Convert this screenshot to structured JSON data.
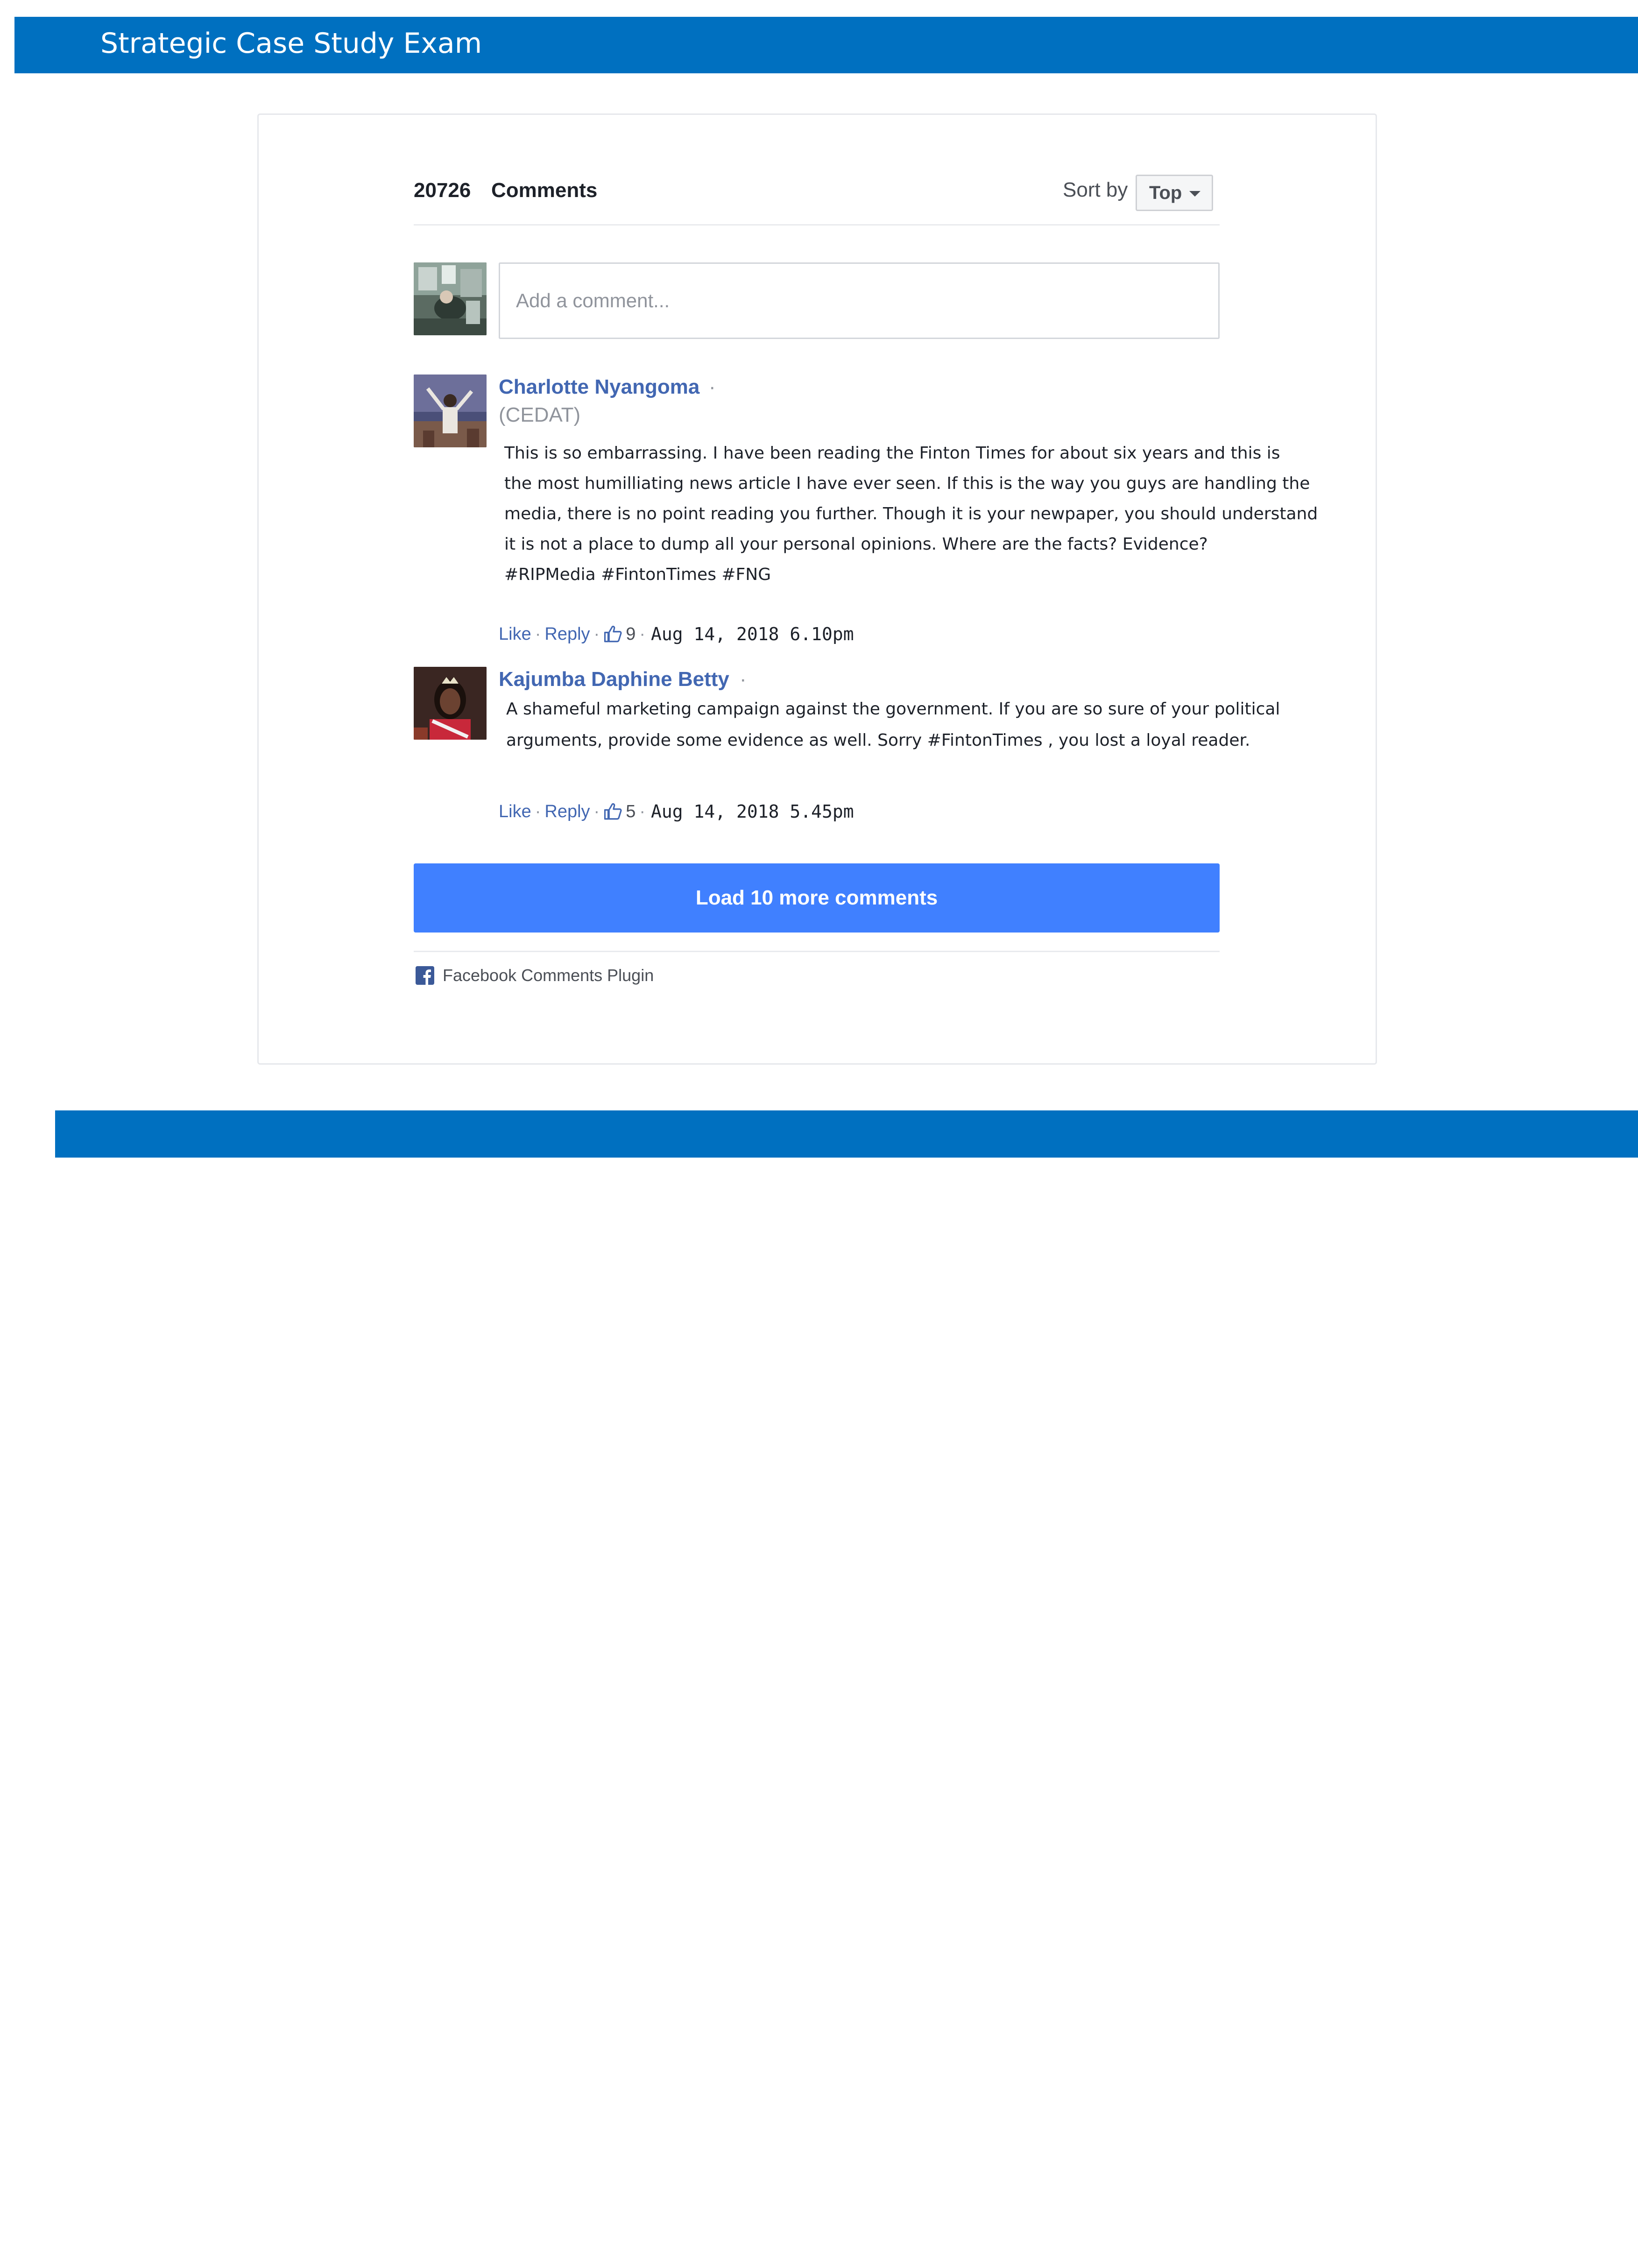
{
  "document": {
    "header_title": "Strategic Case Study Exam"
  },
  "comments_widget": {
    "comment_count": "20726",
    "comments_label": "Comments",
    "sort_by_label": "Sort by",
    "sort_selected": "Top",
    "input_placeholder": "Add a comment...",
    "comments": [
      {
        "author": "Charlotte Nyangoma",
        "separator": "·",
        "affiliation": "(CEDAT)",
        "text_lines": [
          "This is so embarrassing. I have been reading the Finton Times for about six years and this is",
          "the most humilliating news article I have ever seen. If this is the way you guys are handling the",
          "media, there is no point reading you further. Though it is your newpaper, you should understand",
          "it is not a place to dump all your personal opinions. Where are the facts? Evidence?",
          "#RIPMedia #FintonTimes #FNG"
        ],
        "like_label": "Like",
        "reply_label": "Reply",
        "dot": "·",
        "likes": "9",
        "timestamp": "Aug 14, 2018 6.10pm"
      },
      {
        "author": "Kajumba Daphine Betty",
        "separator": "·",
        "text_lines": [
          "A shameful marketing campaign against the government. If you are so sure of your political",
          "arguments, provide some evidence as well. Sorry #FintonTimes , you lost a loyal reader."
        ],
        "like_label": "Like",
        "reply_label": "Reply",
        "dot": "·",
        "likes": "5",
        "timestamp": "Aug 14, 2018 5.45pm"
      }
    ],
    "load_more_label": "Load 10 more comments",
    "plugin_label": "Facebook Comments Plugin"
  },
  "colors": {
    "exam_bar": "#0070c0",
    "author_link": "#4267b2",
    "load_button": "#4080ff",
    "facebook_blue": "#3b5998"
  },
  "icons": {
    "sort_caret": "chevron-down-icon",
    "like": "thumbs-up-icon",
    "facebook": "facebook-icon"
  }
}
